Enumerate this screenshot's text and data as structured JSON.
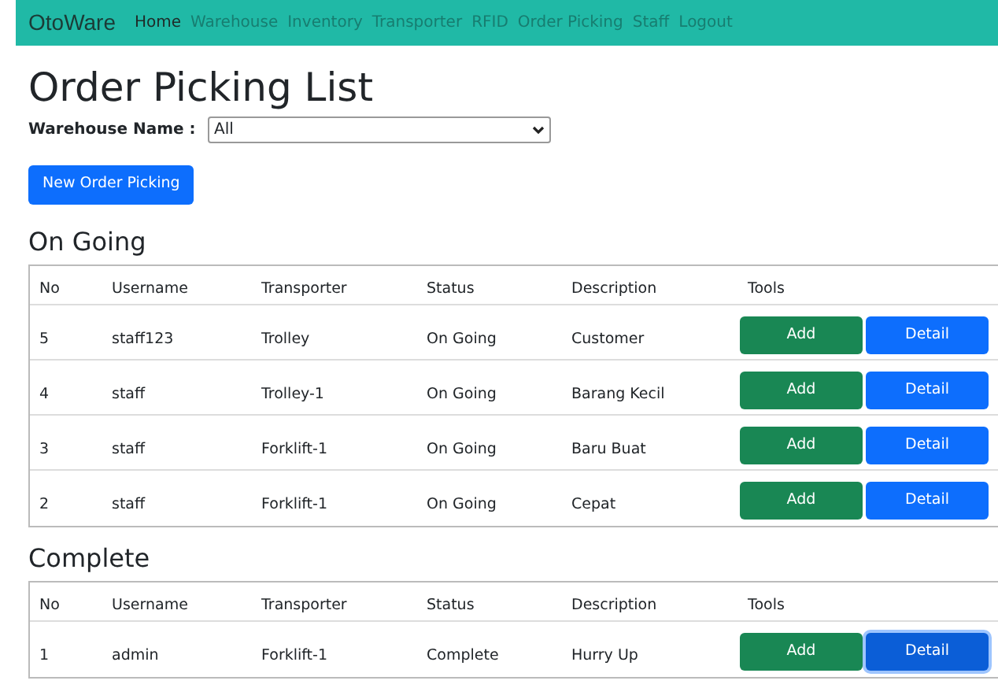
{
  "navbar": {
    "brand": "OtoWare",
    "links": [
      {
        "label": "Home",
        "selected": true
      },
      {
        "label": "Warehouse",
        "selected": false
      },
      {
        "label": "Inventory",
        "selected": false
      },
      {
        "label": "Transporter",
        "selected": false
      },
      {
        "label": "RFID",
        "selected": false
      },
      {
        "label": "Order Picking",
        "selected": false
      },
      {
        "label": "Staff",
        "selected": false
      },
      {
        "label": "Logout",
        "selected": false
      }
    ]
  },
  "title": "Order Picking List",
  "filter": {
    "label": "Warehouse Name :",
    "value": "All"
  },
  "new_button": "New Order Picking",
  "sections": [
    {
      "heading": "On Going",
      "columns": [
        "No",
        "Username",
        "Transporter",
        "Status",
        "Description",
        "Tools"
      ],
      "rows": [
        {
          "no": "5",
          "username": "staff123",
          "transporter": "Trolley",
          "status": "On Going",
          "description": "Customer",
          "add": "Add",
          "detail": "Detail",
          "detail_focused": false
        },
        {
          "no": "4",
          "username": "staff",
          "transporter": "Trolley-1",
          "status": "On Going",
          "description": "Barang Kecil",
          "add": "Add",
          "detail": "Detail",
          "detail_focused": false
        },
        {
          "no": "3",
          "username": "staff",
          "transporter": "Forklift-1",
          "status": "On Going",
          "description": "Baru Buat",
          "add": "Add",
          "detail": "Detail",
          "detail_focused": false
        },
        {
          "no": "2",
          "username": "staff",
          "transporter": "Forklift-1",
          "status": "On Going",
          "description": "Cepat",
          "add": "Add",
          "detail": "Detail",
          "detail_focused": false
        }
      ]
    },
    {
      "heading": "Complete",
      "columns": [
        "No",
        "Username",
        "Transporter",
        "Status",
        "Description",
        "Tools"
      ],
      "rows": [
        {
          "no": "1",
          "username": "admin",
          "transporter": "Forklift-1",
          "status": "Complete",
          "description": "Hurry Up",
          "add": "Add",
          "detail": "Detail",
          "detail_focused": true
        }
      ]
    }
  ]
}
